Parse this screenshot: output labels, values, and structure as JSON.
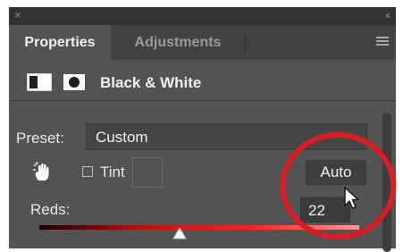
{
  "titlebar": {
    "close_glyph": "×",
    "collapse_glyph": "‹‹"
  },
  "tabs": [
    {
      "label": "Properties",
      "active": true
    },
    {
      "label": "Adjustments",
      "active": false
    }
  ],
  "header": {
    "title": "Black & White",
    "icons": [
      "adjustment-layer-icon",
      "layer-mask-icon"
    ]
  },
  "preset": {
    "label": "Preset:",
    "value": "Custom"
  },
  "tint": {
    "label": "Tint",
    "checked": false
  },
  "auto_button": {
    "label": "Auto"
  },
  "reds": {
    "label": "Reds:",
    "value": "22"
  },
  "colors": {
    "panel_bg": "#535353",
    "highlight": "#d81e24",
    "slider_end": "#ff9a9a"
  },
  "menu_icon": "panel-menu-icon"
}
